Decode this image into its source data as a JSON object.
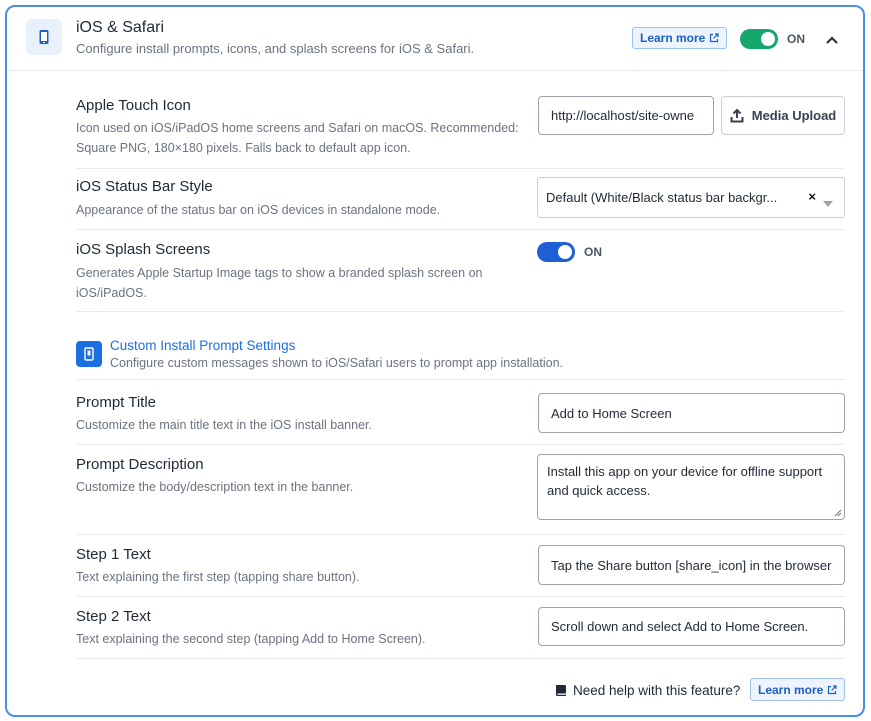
{
  "header": {
    "icon": "mobile-phone-icon",
    "title": "iOS & Safari",
    "description": "Configure install prompts, icons, and splash screens for iOS & Safari.",
    "learn_more_label": "Learn more",
    "toggle_on": true,
    "toggle_label": "ON",
    "collapse_icon": "chevron-up-icon"
  },
  "apple_touch_icon": {
    "title": "Apple Touch Icon",
    "description_line1": "Icon used on iOS/iPadOS home screens and Safari on macOS. Recommended:",
    "description_line2": "Square PNG, 180×180 pixels. Falls back to default app icon.",
    "value": "http://localhost/site-owne",
    "media_button_label": "Media Upload",
    "media_icon": "upload-icon"
  },
  "status_bar": {
    "title": "iOS Status Bar Style",
    "description": "Appearance of the status bar on iOS devices in standalone mode.",
    "selected": "Default (White/Black status bar backgr...",
    "clear_symbol": "×"
  },
  "splash": {
    "title": "iOS Splash Screens",
    "description_line1": "Generates Apple Startup Image tags to show a branded splash screen on",
    "description_line2": "iOS/iPadOS.",
    "toggle_on": true,
    "toggle_label": "ON"
  },
  "install_prompt_section": {
    "icon": "mobile-phone-icon",
    "title": "Custom Install Prompt Settings",
    "description": "Configure custom messages shown to iOS/Safari users to prompt app installation."
  },
  "prompt_title": {
    "title": "Prompt Title",
    "description": "Customize the main title text in the iOS install banner.",
    "value": "Add to Home Screen"
  },
  "prompt_description": {
    "title": "Prompt Description",
    "description": "Customize the body/description text in the banner.",
    "value_line1": "Install this app on your device for offline support",
    "value_line2": "and quick access."
  },
  "step1": {
    "title": "Step 1 Text",
    "description": "Text explaining the first step (tapping share button).",
    "value": "Tap the Share button [share_icon] in the browser"
  },
  "step2": {
    "title": "Step 2 Text",
    "description": "Text explaining the second step (tapping Add to Home Screen).",
    "value": "Scroll down and select Add to Home Screen."
  },
  "footer": {
    "book_icon": "book-icon",
    "help_text": "Need help with this feature?",
    "learn_more_label": "Learn more"
  },
  "colors": {
    "accent": "#1c6fe0",
    "panel_border": "#4a8fe7",
    "toggle_green": "#17a66b",
    "toggle_blue": "#1f5fd6"
  }
}
